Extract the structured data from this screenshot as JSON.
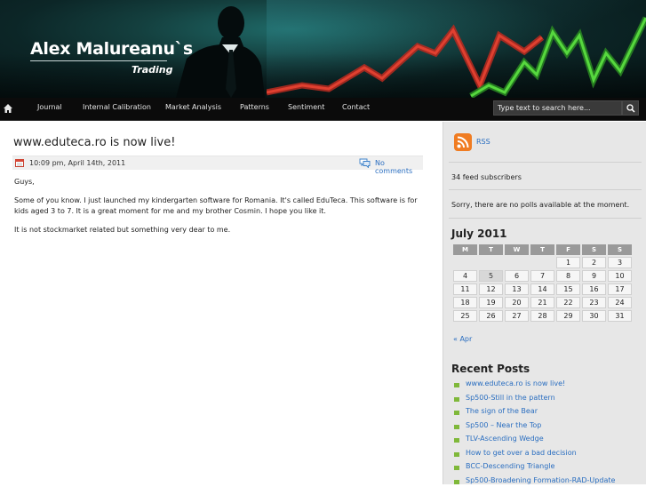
{
  "header": {
    "title": "Alex Malureanu`s",
    "subtitle": "Trading"
  },
  "nav": {
    "items": [
      "Journal",
      "Internal Calibration",
      "Market Analysis",
      "Patterns",
      "Sentiment",
      "Contact"
    ],
    "search_placeholder": "Type text to search here..."
  },
  "post": {
    "title": "www.eduteca.ro is now live!",
    "date": "10:09 pm, April 14th, 2011",
    "comments": "No comments",
    "paragraphs": [
      "Guys,",
      "Some of you know.  I just launched my kindergarten software for Romania. It's called EduTeca. This software is for kids aged 3 to 7. It is a great moment for me and my brother Cosmin. I hope you like it.",
      "It is not stockmarket related but something very dear to me."
    ]
  },
  "sidebar": {
    "rss_label": "RSS",
    "subscribers": "34 feed subscribers",
    "polls": "Sorry, there are no polls available at the moment.",
    "calendar": {
      "title": "July 2011",
      "weekdays": [
        "M",
        "T",
        "W",
        "T",
        "F",
        "S",
        "S"
      ],
      "weeks": [
        [
          "",
          "",
          "",
          "",
          "1",
          "2",
          "3"
        ],
        [
          "4",
          "5",
          "6",
          "7",
          "8",
          "9",
          "10"
        ],
        [
          "11",
          "12",
          "13",
          "14",
          "15",
          "16",
          "17"
        ],
        [
          "18",
          "19",
          "20",
          "21",
          "22",
          "23",
          "24"
        ],
        [
          "25",
          "26",
          "27",
          "28",
          "29",
          "30",
          "31"
        ]
      ],
      "today": "5",
      "prev_link": "« Apr"
    },
    "recent_title": "Recent Posts",
    "recent_posts": [
      "www.eduteca.ro is now live!",
      "Sp500-Still in the pattern",
      "The sign of the Bear",
      "Sp500 – Near the Top",
      "TLV-Ascending Wedge",
      "How to get over a bad decision",
      "BCC-Descending Triangle",
      "Sp500-Broadening Formation-RAD-Update"
    ]
  },
  "colors": {
    "link": "#2a6ec0",
    "bullet": "#7fb83a",
    "trend_green": "#4fd23a",
    "trend_red": "#d13a2a",
    "rss": "#f07c22"
  }
}
